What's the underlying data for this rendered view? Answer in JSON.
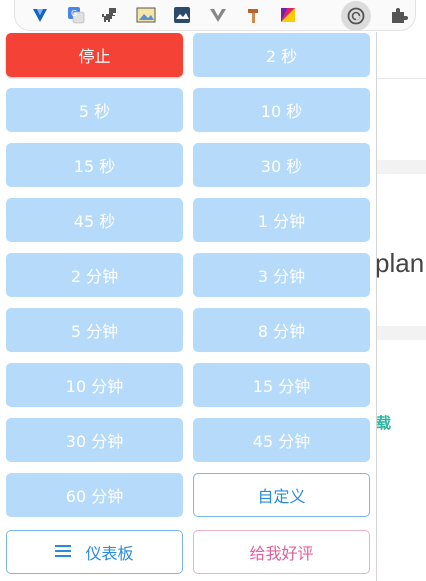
{
  "extensions": {
    "icons": [
      {
        "name": "vue-devtools-icon",
        "color": "#1565c0"
      },
      {
        "name": "translate-icon",
        "color": "#4a86e8"
      },
      {
        "name": "dino-icon",
        "color": "#555555"
      },
      {
        "name": "image-viewer-icon",
        "color": "#c9a227"
      },
      {
        "name": "cloud-image-icon",
        "color": "#2c4a6a"
      },
      {
        "name": "vue-logo-icon",
        "color": "#888888"
      },
      {
        "name": "hammer-icon",
        "color": "#b9622c"
      },
      {
        "name": "color-picker-icon",
        "color": "#e91e63"
      },
      {
        "name": "auto-refresh-icon",
        "color": "#555555"
      },
      {
        "name": "puzzle-icon",
        "color": "#555555"
      }
    ]
  },
  "background_page": {
    "visible_text": "plan",
    "accent_text": "载"
  },
  "popup": {
    "stop_label": "停止",
    "intervals": [
      "2 秒",
      "5 秒",
      "10 秒",
      "15 秒",
      "30 秒",
      "45 秒",
      "1 分钟",
      "2 分钟",
      "3 分钟",
      "5 分钟",
      "8 分钟",
      "10 分钟",
      "15 分钟",
      "30 分钟",
      "45 分钟",
      "60 分钟"
    ],
    "custom_label": "自定义",
    "dashboard_label": "仪表板",
    "rate_label": "给我好评"
  },
  "colors": {
    "stop": "#f44336",
    "interval_button": "#b6dbfa",
    "dashboard_outline": "#7ab8ea",
    "rate_outline": "#eab2c8",
    "rate_text": "#e0609a"
  }
}
